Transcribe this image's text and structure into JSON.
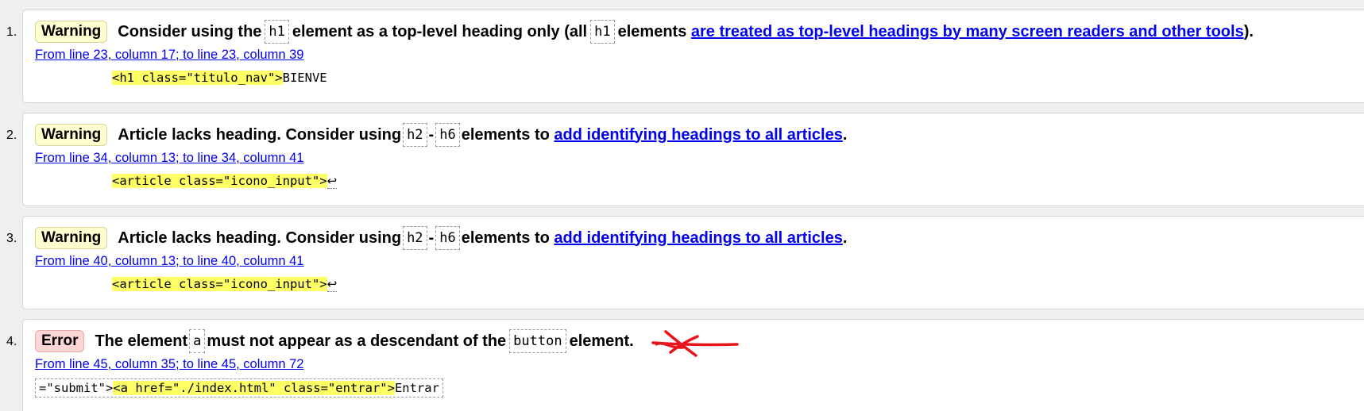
{
  "messages": [
    {
      "number": "1.",
      "type": "Warning",
      "text_before": "Consider using the",
      "code1": "h1",
      "text_middle": "element as a top-level heading only (all",
      "code2": "h1",
      "text_after": "elements",
      "link": "are treated as top-level headings by many screen readers and other tools",
      "text_end": ").",
      "location": "From line 23, column 17; to line 23, column 39",
      "extract_highlight": "<h1 class=\"titulo_nav\">",
      "extract_rest": "BIENVE"
    },
    {
      "number": "2.",
      "type": "Warning",
      "text_before": "Article lacks heading. Consider using",
      "code1": "h2",
      "separator": "-",
      "code2": "h6",
      "text_after": "elements to",
      "link": "add identifying headings to all articles",
      "text_end": ".",
      "location": "From line 34, column 13; to line 34, column 41",
      "extract_highlight": "<article class=\"icono_input\">",
      "extract_newline": "↩"
    },
    {
      "number": "3.",
      "type": "Warning",
      "text_before": "Article lacks heading. Consider using",
      "code1": "h2",
      "separator": "-",
      "code2": "h6",
      "text_after": "elements to",
      "link": "add identifying headings to all articles",
      "text_end": ".",
      "location": "From line 40, column 13; to line 40, column 41",
      "extract_highlight": "<article class=\"icono_input\">",
      "extract_newline": "↩"
    },
    {
      "number": "4.",
      "type": "Error",
      "text_before": "The element",
      "code1": "a",
      "text_middle": "must not appear as a descendant of the",
      "code2": "button",
      "text_after": "element.",
      "location": "From line 45, column 35; to line 45, column 72",
      "extract_prefix": "=\"submit\">",
      "extract_highlight": "<a href=\"./index.html\" class=\"entrar\">",
      "extract_rest": "Entrar"
    }
  ],
  "colors": {
    "warning_badge": "#ffffd0",
    "error_badge": "#fcd5d5",
    "link": "#0000ee",
    "highlight": "#ffff66",
    "annotation": "#e8141c"
  }
}
